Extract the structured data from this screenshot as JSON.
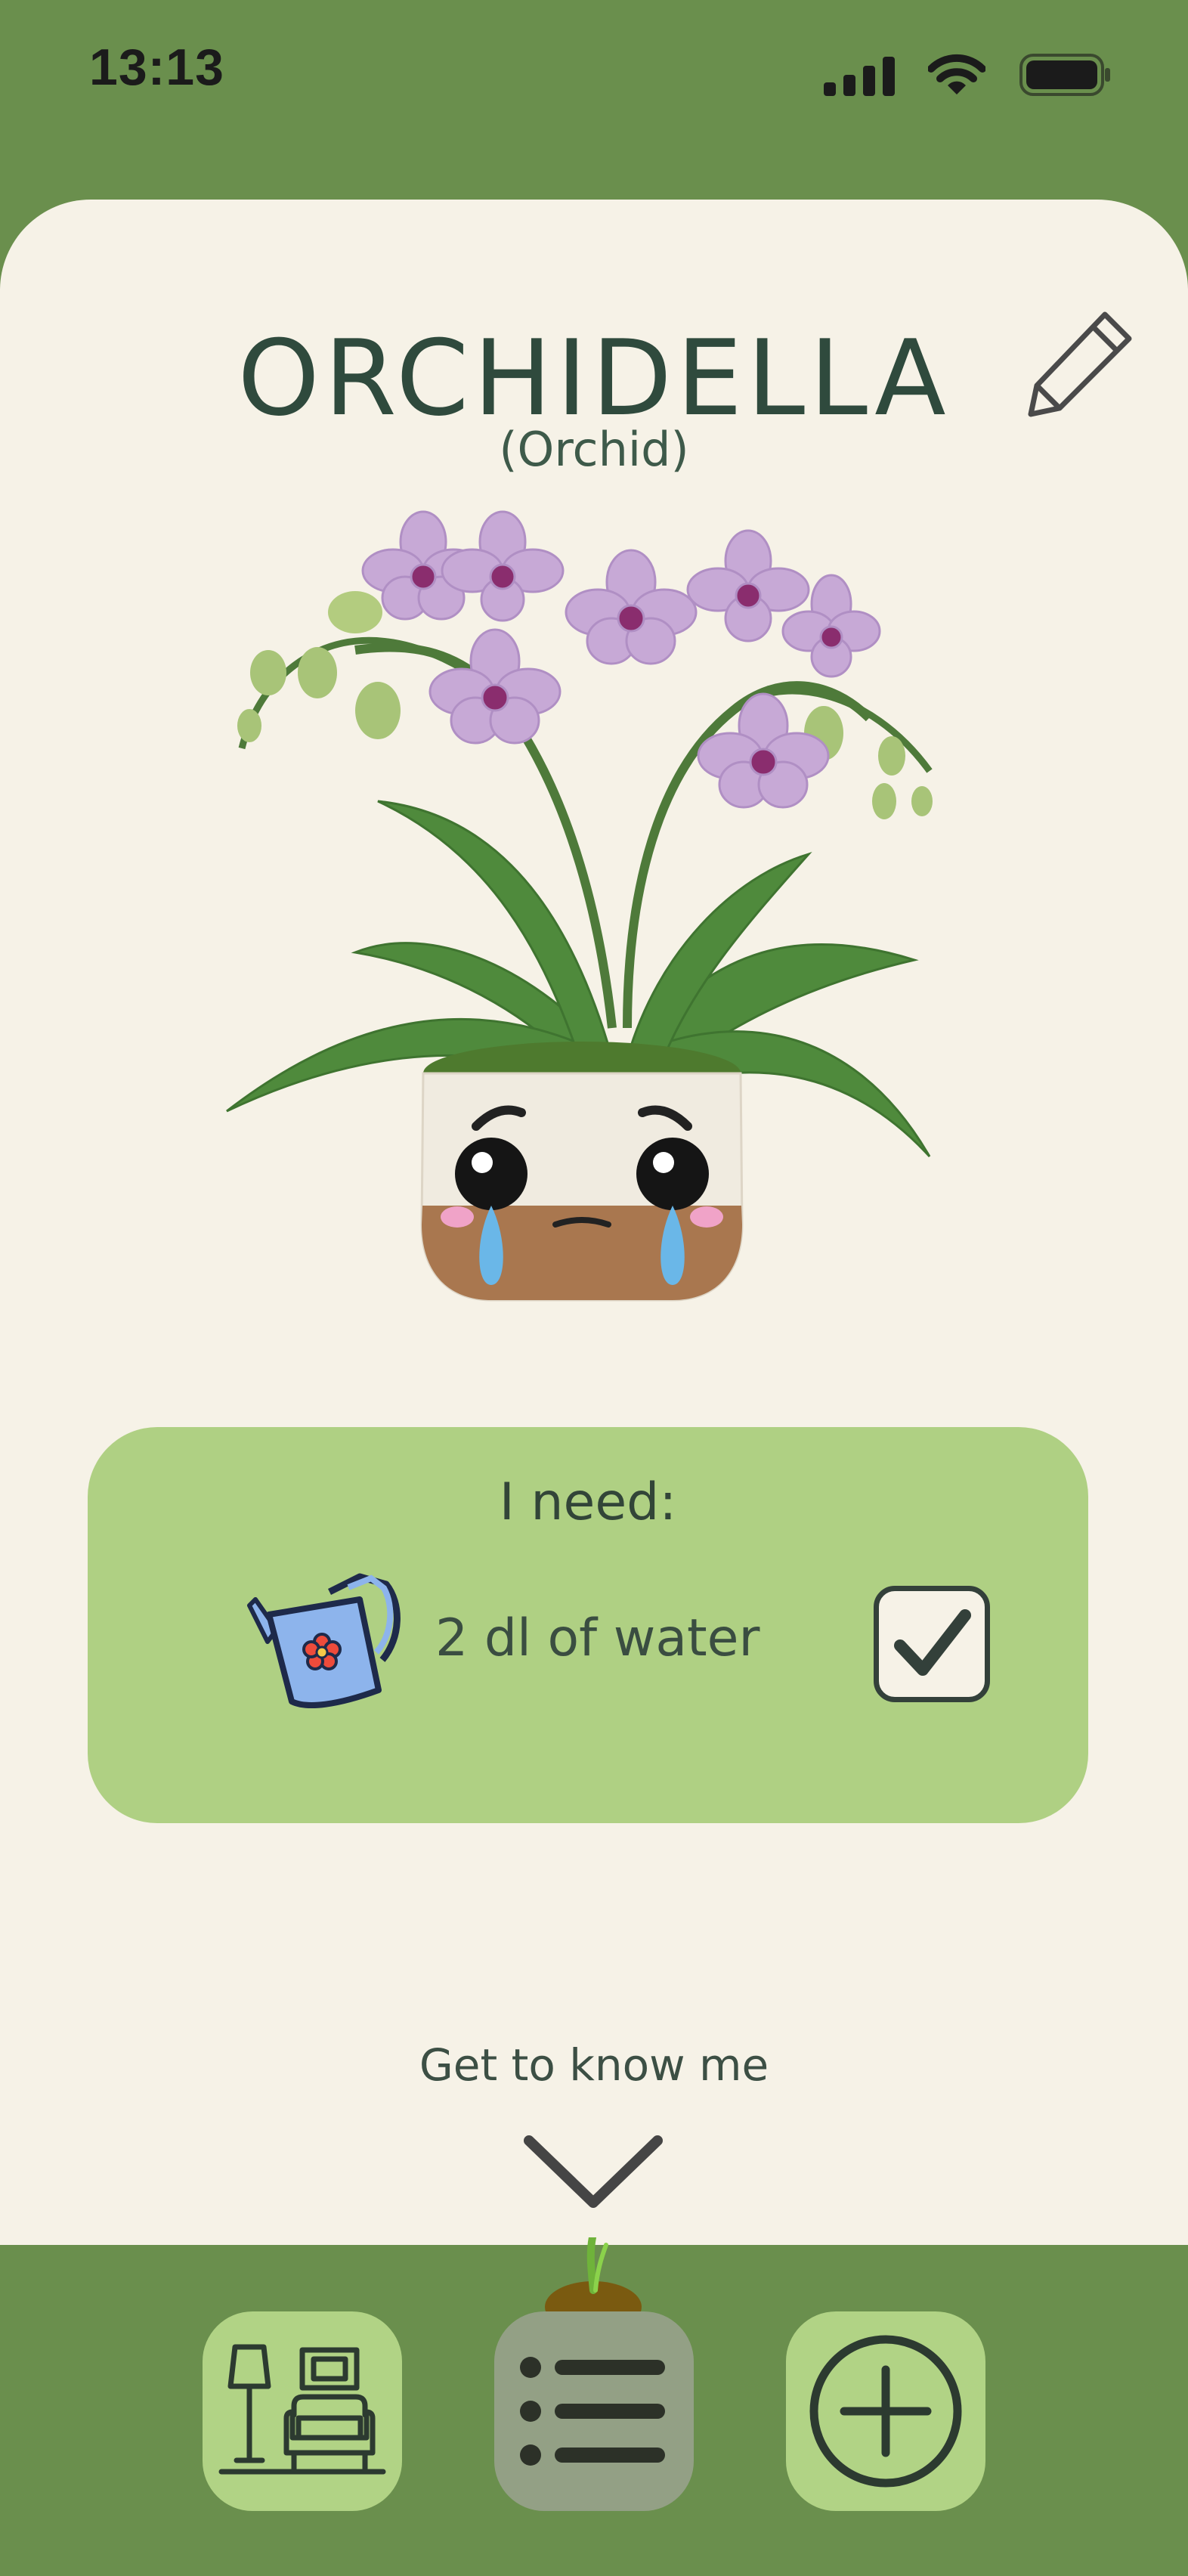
{
  "status_bar": {
    "time": "13:13",
    "icons": [
      "signal-icon",
      "wifi-icon",
      "battery-icon"
    ]
  },
  "plant": {
    "name": "ORCHIDELLA",
    "species": "(Orchid)",
    "mood": "crying",
    "edit_icon": "pencil-icon"
  },
  "needs": {
    "title": "I need:",
    "items": [
      {
        "icon": "watering-can-icon",
        "text": "2 dl of water",
        "checked": true
      }
    ]
  },
  "footer": {
    "get_to_know_label": "Get to know me",
    "chevron_icon": "chevron-down-icon"
  },
  "nav": {
    "items": [
      {
        "icon": "living-room-icon",
        "active": false
      },
      {
        "icon": "list-icon",
        "active": true
      },
      {
        "icon": "add-circle-icon",
        "active": false
      }
    ]
  },
  "colors": {
    "background": "#6a8f4d",
    "card": "#f6f2e7",
    "panel": "#afd083",
    "nav_button": "#b1d385",
    "nav_button_active": "#93a085",
    "title": "#2f4a3d"
  }
}
